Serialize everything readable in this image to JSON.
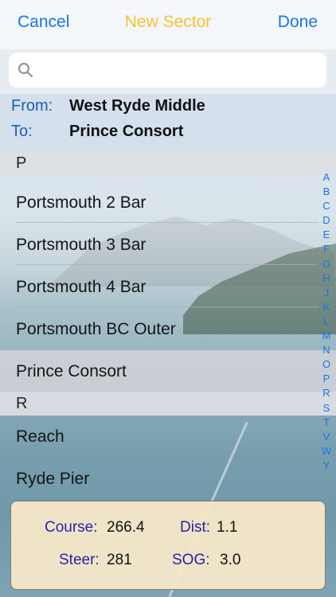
{
  "nav": {
    "cancel_label": "Cancel",
    "title": "New Sector",
    "done_label": "Done"
  },
  "search": {
    "placeholder": "",
    "value": ""
  },
  "sector": {
    "from_label": "From:",
    "from_value": "West Ryde Middle",
    "to_label": "To:",
    "to_value": "Prince Consort"
  },
  "list": {
    "sections": [
      {
        "header": "P",
        "items": [
          "Portsmouth 2 Bar",
          "Portsmouth 3 Bar",
          "Portsmouth 4 Bar",
          "Portsmouth BC Outer",
          "Prince Consort"
        ]
      },
      {
        "header": "R",
        "items": [
          "Reach",
          "Ryde Pier"
        ]
      }
    ],
    "selected_item": "Prince Consort"
  },
  "index_letters": [
    "A",
    "B",
    "C",
    "D",
    "E",
    "F",
    "G",
    "H",
    "J",
    "K",
    "L",
    "M",
    "N",
    "O",
    "P",
    "R",
    "S",
    "T",
    "V",
    "W",
    "Y"
  ],
  "info": {
    "course_label": "Course:",
    "course_value": "266.4",
    "dist_label": "Dist:",
    "dist_value": "1.1",
    "steer_label": "Steer:",
    "steer_value": "281",
    "sog_label": "SOG:",
    "sog_value": "3.0"
  },
  "colors": {
    "accent": "#1a73e8",
    "title": "#f5c232",
    "panel_bg": "#f6e8c8",
    "panel_label": "#2a1fa8"
  },
  "icons": {
    "search": "magnifier-icon"
  }
}
